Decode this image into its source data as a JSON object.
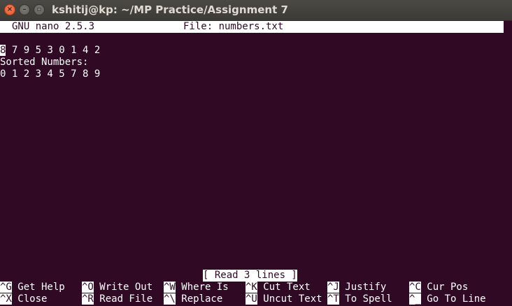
{
  "window": {
    "title": "kshitij@kp: ~/MP Practice/Assignment 7",
    "close_glyph": "×",
    "minimize_glyph": "–",
    "maximize_glyph": "▫"
  },
  "nano": {
    "version": "GNU nano 2.5.3",
    "file_label": "File: numbers.txt"
  },
  "content": {
    "cursor_char": "8",
    "line1_rest": " 7 9 5 3 0 1 4 2",
    "line2": "Sorted Numbers:",
    "line3": "0 1 2 3 4 5 7 8 9"
  },
  "status": "[ Read 3 lines ]",
  "shortcuts": [
    [
      {
        "key": "^G",
        "label": " Get Help"
      },
      {
        "key": "^O",
        "label": " Write Out"
      },
      {
        "key": "^W",
        "label": " Where Is"
      },
      {
        "key": "^K",
        "label": " Cut Text"
      },
      {
        "key": "^J",
        "label": " Justify"
      },
      {
        "key": "^C",
        "label": " Cur Pos"
      }
    ],
    [
      {
        "key": "^X",
        "label": " Close"
      },
      {
        "key": "^R",
        "label": " Read File"
      },
      {
        "key": "^\\",
        "label": " Replace"
      },
      {
        "key": "^U",
        "label": " Uncut Text"
      },
      {
        "key": "^T",
        "label": " To Spell"
      },
      {
        "key": "^_",
        "label": " Go To Line"
      }
    ]
  ],
  "colors": {
    "terminal_bg": "#300a24",
    "terminal_fg": "#ffffff",
    "titlebar_bg": "#3c3b37",
    "close_button": "#e3541f"
  }
}
